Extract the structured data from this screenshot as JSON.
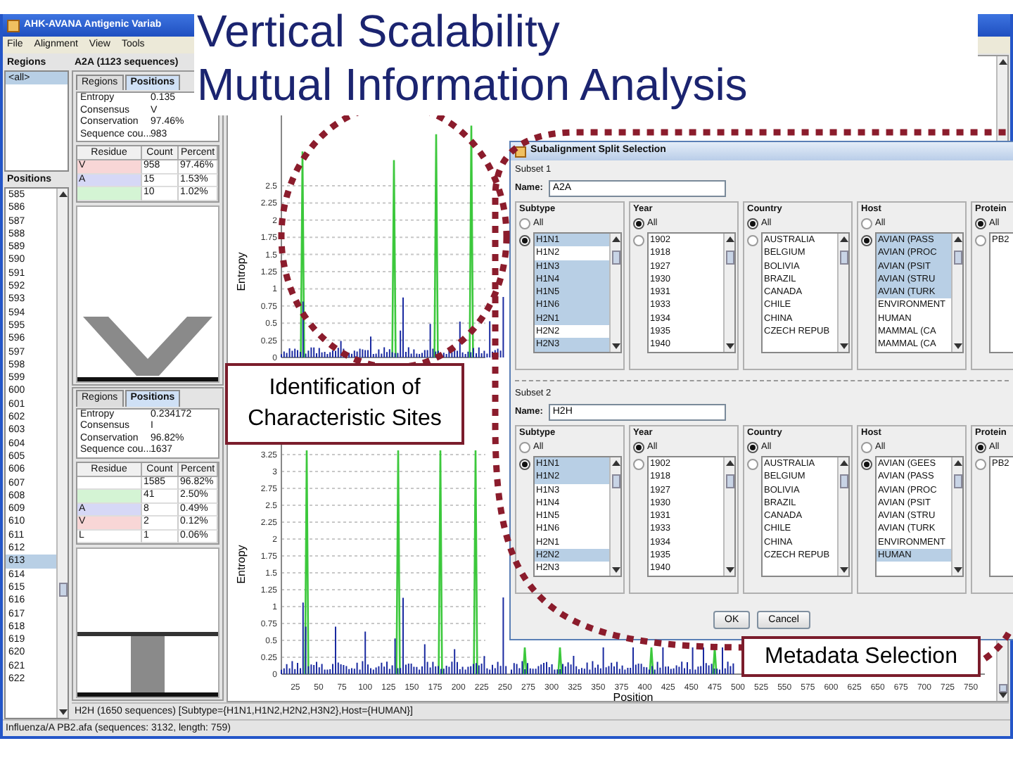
{
  "slide_title": {
    "lines": [
      "Vertical Scalability",
      "Mutual Information Analysis"
    ]
  },
  "app": {
    "title": "AHK-AVANA Antigenic Variab",
    "menu": [
      "File",
      "Alignment",
      "View",
      "Tools"
    ],
    "regions": {
      "header": "Regions",
      "items": [
        {
          "label": "<all>",
          "selected": true
        }
      ]
    },
    "positions": {
      "header": "Positions",
      "items": [
        {
          "label": "585",
          "selected": false
        },
        {
          "label": "586",
          "selected": false
        },
        {
          "label": "587",
          "selected": false
        },
        {
          "label": "588",
          "selected": false
        },
        {
          "label": "589",
          "selected": false
        },
        {
          "label": "590",
          "selected": false
        },
        {
          "label": "591",
          "selected": false
        },
        {
          "label": "592",
          "selected": false
        },
        {
          "label": "593",
          "selected": false
        },
        {
          "label": "594",
          "selected": false
        },
        {
          "label": "595",
          "selected": false
        },
        {
          "label": "596",
          "selected": false
        },
        {
          "label": "597",
          "selected": false
        },
        {
          "label": "598",
          "selected": false
        },
        {
          "label": "599",
          "selected": false
        },
        {
          "label": "600",
          "selected": false
        },
        {
          "label": "601",
          "selected": false
        },
        {
          "label": "602",
          "selected": false
        },
        {
          "label": "603",
          "selected": false
        },
        {
          "label": "604",
          "selected": false
        },
        {
          "label": "605",
          "selected": false
        },
        {
          "label": "606",
          "selected": false
        },
        {
          "label": "607",
          "selected": false
        },
        {
          "label": "608",
          "selected": false
        },
        {
          "label": "609",
          "selected": false
        },
        {
          "label": "610",
          "selected": false
        },
        {
          "label": "611",
          "selected": false
        },
        {
          "label": "612",
          "selected": false
        },
        {
          "label": "613",
          "selected": true
        },
        {
          "label": "614",
          "selected": false
        },
        {
          "label": "615",
          "selected": false
        },
        {
          "label": "616",
          "selected": false
        },
        {
          "label": "617",
          "selected": false
        },
        {
          "label": "618",
          "selected": false
        },
        {
          "label": "619",
          "selected": false
        },
        {
          "label": "620",
          "selected": false
        },
        {
          "label": "621",
          "selected": false
        },
        {
          "label": "622",
          "selected": false
        }
      ]
    },
    "header": "A2A (1123 sequences)",
    "panels": [
      {
        "tabs": [
          {
            "label": "Regions",
            "selected": false
          },
          {
            "label": "Positions",
            "selected": true
          }
        ],
        "properties": [
          {
            "name": "Entropy",
            "value": "0.135"
          },
          {
            "name": "Consensus",
            "value": "V"
          },
          {
            "name": "Conservation",
            "value": "97.46%"
          },
          {
            "name": "Sequence cou...",
            "value": "983"
          }
        ],
        "residue_table": {
          "columns": [
            "Residue",
            "Count",
            "Percent"
          ],
          "rows": [
            {
              "residue": "V",
              "count": "958",
              "percent": "97.46%",
              "color": "#f8d6d6"
            },
            {
              "residue": "A",
              "count": "15",
              "percent": "1.53%",
              "color": "#d6d8f6"
            },
            {
              "count": "10",
              "percent": "1.02%",
              "color": "#d4f4d4"
            }
          ]
        },
        "kind": "chevron"
      },
      {
        "tabs": [
          {
            "label": "Regions",
            "selected": false
          },
          {
            "label": "Positions",
            "selected": true
          }
        ],
        "properties": [
          {
            "name": "Entropy",
            "value": "0.234172"
          },
          {
            "name": "Consensus",
            "value": "I"
          },
          {
            "name": "Conservation",
            "value": "96.82%"
          },
          {
            "name": "Sequence cou...",
            "value": "1637"
          }
        ],
        "residue_table": {
          "columns": [
            "Residue",
            "Count",
            "Percent"
          ],
          "rows": [
            {
              "count": "1585",
              "percent": "96.82%",
              "color": "#ffffff"
            },
            {
              "count": "41",
              "percent": "2.50%",
              "color": "#d4f4d4"
            },
            {
              "residue": "A",
              "count": "8",
              "percent": "0.49%",
              "color": "#d6d8f6"
            },
            {
              "residue": "V",
              "count": "2",
              "percent": "0.12%",
              "color": "#f8d6d6"
            },
            {
              "residue": "L",
              "count": "1",
              "percent": "0.06%",
              "color": "#ffffff"
            }
          ]
        },
        "kind": "pillar"
      }
    ],
    "plots": [
      {
        "ylabel": "Entropy",
        "yticks": [
          "2.5",
          "2.25",
          "2",
          "1.75",
          "1.5",
          "1.25",
          "1",
          "0.75",
          "0.5",
          "0.25",
          "0"
        ]
      },
      {
        "ylabel": "Entropy",
        "yticks": [
          "3.25",
          "3",
          "2.75",
          "2.5",
          "2.25",
          "2",
          "1.75",
          "1.5",
          "1.25",
          "1",
          "0.75",
          "0.5",
          "0.25",
          "0"
        ],
        "xticks": [
          "25",
          "50",
          "75",
          "100",
          "125",
          "150",
          "175",
          "200",
          "225",
          "250",
          "275",
          "300",
          "325",
          "350",
          "375",
          "400",
          "425",
          "450",
          "475",
          "500",
          "525",
          "550",
          "575",
          "600",
          "625",
          "650",
          "675",
          "700",
          "725",
          "750"
        ],
        "xlabel": "Position"
      }
    ],
    "status": [
      "H2H (1650 sequences) [Subtype={H1N1,H1N2,H2N2,H3N2},Host={HUMAN}]",
      "Influenza/A PB2.afa (sequences: 3132, length: 759)"
    ]
  },
  "dialog": {
    "title": "Subalignment Split Selection",
    "subsets": [
      {
        "label": "Subset 1",
        "name_label": "Name:",
        "name_value": "A2A",
        "groups": [
          {
            "legend": "Subtype",
            "options": [
              {
                "label": "All",
                "selected": false
              },
              {
                "selected": true
              }
            ],
            "items": [
              {
                "label": "H1N1",
                "selected": true
              },
              {
                "label": "H1N2",
                "selected": false
              },
              {
                "label": "H1N3",
                "selected": true
              },
              {
                "label": "H1N4",
                "selected": true
              },
              {
                "label": "H1N5",
                "selected": true
              },
              {
                "label": "H1N6",
                "selected": true
              },
              {
                "label": "H2N1",
                "selected": true
              },
              {
                "label": "H2N2",
                "selected": false
              },
              {
                "label": "H2N3",
                "selected": true
              }
            ]
          },
          {
            "legend": "Year",
            "options": [
              {
                "label": "All",
                "selected": true
              },
              {
                "selected": false
              }
            ],
            "items": [
              {
                "label": "1902",
                "selected": false
              },
              {
                "label": "1918",
                "selected": false
              },
              {
                "label": "1927",
                "selected": false
              },
              {
                "label": "1930",
                "selected": false
              },
              {
                "label": "1931",
                "selected": false
              },
              {
                "label": "1933",
                "selected": false
              },
              {
                "label": "1934",
                "selected": false
              },
              {
                "label": "1935",
                "selected": false
              },
              {
                "label": "1940",
                "selected": false
              }
            ]
          },
          {
            "legend": "Country",
            "options": [
              {
                "label": "All",
                "selected": true
              },
              {
                "selected": false
              }
            ],
            "items": [
              {
                "label": "AUSTRALIA",
                "selected": false
              },
              {
                "label": "BELGIUM",
                "selected": false
              },
              {
                "label": "BOLIVIA",
                "selected": false
              },
              {
                "label": "BRAZIL",
                "selected": false
              },
              {
                "label": "CANADA",
                "selected": false
              },
              {
                "label": "CHILE",
                "selected": false
              },
              {
                "label": "CHINA",
                "selected": false
              },
              {
                "label": "CZECH REPUB",
                "selected": false
              }
            ]
          },
          {
            "legend": "Host",
            "options": [
              {
                "label": "All",
                "selected": false
              },
              {
                "selected": true
              }
            ],
            "items": [
              {
                "label": "AVIAN (PASS",
                "selected": true
              },
              {
                "label": "AVIAN (PROC",
                "selected": true
              },
              {
                "label": "AVIAN (PSIT",
                "selected": true
              },
              {
                "label": "AVIAN (STRU",
                "selected": true
              },
              {
                "label": "AVIAN (TURK",
                "selected": true
              },
              {
                "label": "ENVIRONMENT",
                "selected": false
              },
              {
                "label": "HUMAN",
                "selected": false
              },
              {
                "label": "MAMMAL (CA",
                "selected": false
              },
              {
                "label": "MAMMAL (CA",
                "selected": false
              }
            ]
          },
          {
            "legend": "Protein",
            "options": [
              {
                "label": "All",
                "selected": true
              },
              {
                "selected": false
              }
            ],
            "items": [
              {
                "label": "PB2",
                "selected": false
              }
            ]
          }
        ]
      },
      {
        "label": "Subset 2",
        "name_label": "Name:",
        "name_value": "H2H",
        "groups": [
          {
            "legend": "Subtype",
            "options": [
              {
                "label": "All",
                "selected": false
              },
              {
                "selected": true
              }
            ],
            "items": [
              {
                "label": "H1N1",
                "selected": true
              },
              {
                "label": "H1N2",
                "selected": true
              },
              {
                "label": "H1N3",
                "selected": false
              },
              {
                "label": "H1N4",
                "selected": false
              },
              {
                "label": "H1N5",
                "selected": false
              },
              {
                "label": "H1N6",
                "selected": false
              },
              {
                "label": "H2N1",
                "selected": false
              },
              {
                "label": "H2N2",
                "selected": true
              },
              {
                "label": "H2N3",
                "selected": false
              }
            ]
          },
          {
            "legend": "Year",
            "options": [
              {
                "label": "All",
                "selected": true
              },
              {
                "selected": false
              }
            ],
            "items": [
              {
                "label": "1902",
                "selected": false
              },
              {
                "label": "1918",
                "selected": false
              },
              {
                "label": "1927",
                "selected": false
              },
              {
                "label": "1930",
                "selected": false
              },
              {
                "label": "1931",
                "selected": false
              },
              {
                "label": "1933",
                "selected": false
              },
              {
                "label": "1934",
                "selected": false
              },
              {
                "label": "1935",
                "selected": false
              },
              {
                "label": "1940",
                "selected": false
              }
            ]
          },
          {
            "legend": "Country",
            "options": [
              {
                "label": "All",
                "selected": true
              },
              {
                "selected": false
              }
            ],
            "items": [
              {
                "label": "AUSTRALIA",
                "selected": false
              },
              {
                "label": "BELGIUM",
                "selected": false
              },
              {
                "label": "BOLIVIA",
                "selected": false
              },
              {
                "label": "BRAZIL",
                "selected": false
              },
              {
                "label": "CANADA",
                "selected": false
              },
              {
                "label": "CHILE",
                "selected": false
              },
              {
                "label": "CHINA",
                "selected": false
              },
              {
                "label": "CZECH REPUB",
                "selected": false
              }
            ]
          },
          {
            "legend": "Host",
            "options": [
              {
                "label": "All",
                "selected": false
              },
              {
                "selected": true
              }
            ],
            "items": [
              {
                "label": "AVIAN (GEES",
                "selected": false
              },
              {
                "label": "AVIAN (PASS",
                "selected": false
              },
              {
                "label": "AVIAN (PROC",
                "selected": false
              },
              {
                "label": "AVIAN (PSIT",
                "selected": false
              },
              {
                "label": "AVIAN (STRU",
                "selected": false
              },
              {
                "label": "AVIAN (TURK",
                "selected": false
              },
              {
                "label": "ENVIRONMENT",
                "selected": false
              },
              {
                "label": "HUMAN",
                "selected": true
              }
            ]
          },
          {
            "legend": "Protein",
            "options": [
              {
                "label": "All",
                "selected": true
              },
              {
                "selected": false
              }
            ],
            "items": [
              {
                "label": "PB2",
                "selected": false
              }
            ]
          }
        ]
      }
    ],
    "buttons": [
      "OK",
      "Cancel"
    ]
  },
  "callouts": [
    {
      "text": "Identification of Characteristic Sites"
    },
    {
      "text": "Metadata Selection"
    }
  ]
}
